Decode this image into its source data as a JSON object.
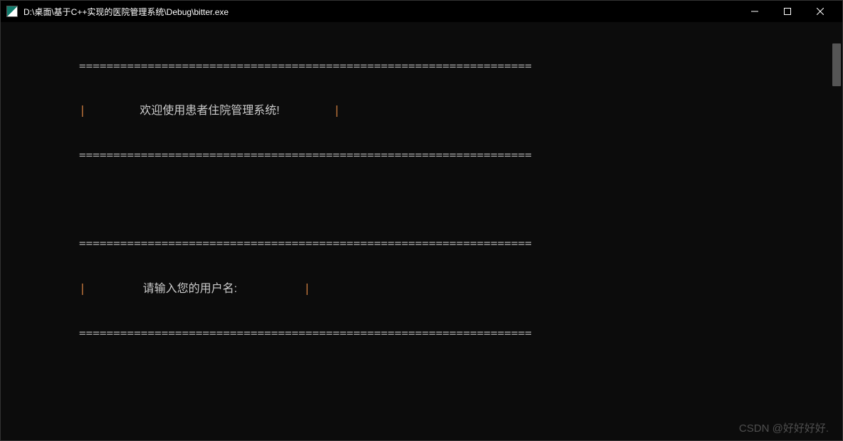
{
  "titlebar": {
    "title": "D:\\桌面\\基于C++实现的医院管理系统\\Debug\\bitter.exe"
  },
  "console": {
    "divider": "==================================================================",
    "side": "|",
    "welcome_text": "欢迎使用患者住院管理系统!",
    "prompt_text": "请输入您的用户名:"
  },
  "watermark": "CSDN @好好好好."
}
